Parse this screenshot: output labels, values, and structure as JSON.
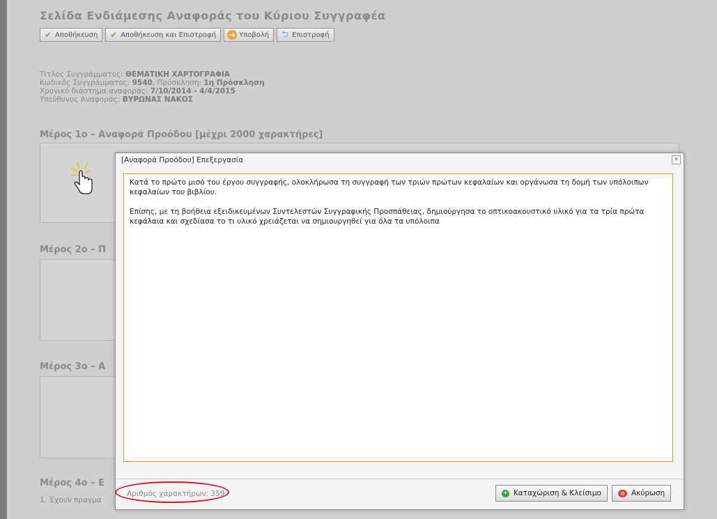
{
  "page": {
    "title": "Σελίδα Ενδιάμεσης Αναφοράς του Κύριου Συγγραφέα",
    "toolbar": {
      "save": "Αποθήκευση",
      "save_return": "Αποθήκευση και Επιστροφή",
      "submit": "Υποβολή",
      "back": "Επιστροφή"
    },
    "info": {
      "book_title_label": "Τίτλος Συγγράμματος:",
      "book_title": "ΘΕΜΑΤΙΚΗ ΧΑΡΤΟΓΡΑΦΙΑ",
      "code_label": "Κωδικός Συγγράμματος:",
      "code": "9540",
      "call_label": ", Πρόσκληση:",
      "call": "1η Πρόσκληση",
      "period_label": "Χρονικό διάστημα αναφοράς:",
      "period": "7/10/2014 - 4/4/2015",
      "responsible_label": "Υπεύθυνος Αναφοράς:",
      "responsible": "ΒΥΡΩΝΑΣ ΝΑΚΟΣ"
    },
    "sections": [
      "Μέρος 1ο – Αναφορά Προόδου [μέχρι 2000 χαρακτήρες]",
      "Μέρος 2ο – Π",
      "Μέρος 3ο – Α",
      "Μέρος 4ο – Ε"
    ],
    "question1": "1. Έχουν πραγμα"
  },
  "dialog": {
    "title": "[Αναφορά Προόδου] Επεξεργασία",
    "close": "×",
    "paragraph1": "Κατά το πρώτο μισό του έργου συγγραφής, ολοκλήρωσα τη συγγραφή των τριών πρώτων κεφαλαίων και οργάνωσα τη δομή των υπόλοιπων κεφαλαίων του βιβλίου.",
    "paragraph2": "Επίσης, με τη βοήθεια εξειδικευμένων Συντελεστών Συγγραφικής Προσπάθειας, δημιούργησα το οπτικοακουστικό υλικό για τα τρία πρώτα κεφάλαια και σχεδίασα το τι υλικό χρειάζεται να σημιουργηθεί για όλα τα υπόλοιπα",
    "char_count": "Αριθμός χαρακτήρων: 359",
    "save_close": "Καταχώριση & Κλείσιμο",
    "cancel": "Ακύρωση"
  },
  "colors": {
    "highlight_oval": "#e0101a",
    "editor_border": "#e39a2c"
  }
}
